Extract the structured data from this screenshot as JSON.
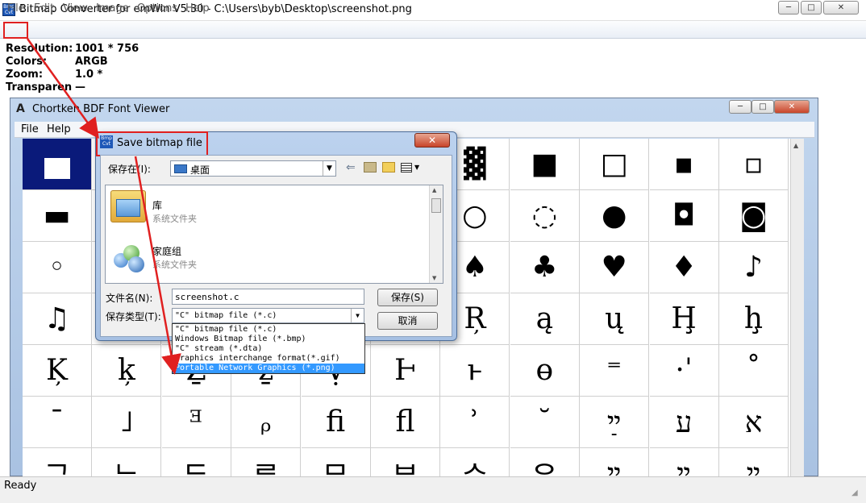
{
  "window": {
    "title": "Bitmap Converter for emWin V5.30 - C:\\Users\\byb\\Desktop\\screenshot.png",
    "icon_text": "Bmp Cvt",
    "minimize": "─",
    "maximize": "□",
    "close": "✕"
  },
  "menu": [
    "File",
    "Edit",
    "View",
    "Image",
    "Options",
    "Help"
  ],
  "info": {
    "resolution_label": "Resolution:",
    "resolution_value": "1001 * 756",
    "colors_label": "Colors:",
    "colors_value": "ARGB",
    "zoom_label": "Zoom:",
    "zoom_value": "1.0 *",
    "transparency_label": "Transparen",
    "transparency_value": "—"
  },
  "viewer": {
    "title": "Chortkeh BDF Font Viewer",
    "menu": [
      "File",
      "Help"
    ],
    "glyphs": [
      [
        "",
        "",
        "",
        "",
        "",
        "",
        "▓",
        "■",
        "□",
        "▪",
        "▫"
      ],
      [
        "▬",
        "",
        "",
        "",
        "",
        "",
        "○",
        "◌",
        "●",
        "◘",
        "◙"
      ],
      [
        "◦",
        "",
        "",
        "",
        "",
        "",
        "♠",
        "♣",
        "♥",
        "♦",
        "♪"
      ],
      [
        "♫",
        "",
        "",
        "",
        "",
        "",
        "Ŗ",
        "ą",
        "ų",
        "Ḩ",
        "ḩ"
      ],
      [
        "Ķ",
        "ķ",
        "Ẕ",
        "ẕ",
        "Ṿ",
        "Ͱ",
        "ͱ",
        "ɵ",
        "⁼",
        "·ˈ",
        "˚"
      ],
      [
        "ˉ",
        "˩",
        "ᴲ",
        "ᵨ",
        "ﬁ",
        "ﬂ",
        "ʾ",
        "˘",
        "ײַ",
        "ע",
        "א"
      ],
      [
        "ᄀ",
        "ᄂ",
        "ᄃ",
        "ᄅ",
        "ᄆ",
        "ᄇ",
        "ᄉ",
        "ᄋ",
        "ײ",
        "ײ",
        "ײ"
      ]
    ]
  },
  "dialog": {
    "title": "Save bitmap file",
    "save_in_label": "保存在(I):",
    "save_in_value": "桌面",
    "places": [
      {
        "name": "库",
        "type": "系统文件夹",
        "icon": "library-icon"
      },
      {
        "name": "家庭组",
        "type": "系统文件夹",
        "icon": "homegroup-icon"
      }
    ],
    "filename_label": "文件名(N):",
    "filename_value": "screenshot.c",
    "filetype_label": "保存类型(T):",
    "filetype_value": "\"C\" bitmap file (*.c)",
    "save_button": "保存(S)",
    "cancel_button": "取消",
    "filetype_options": [
      "\"C\" bitmap file (*.c)",
      "Windows Bitmap file (*.bmp)",
      "\"C\" stream (*.dta)",
      "Graphics interchange format(*.gif)",
      "Portable Network Graphics (*.png)"
    ],
    "selected_option_index": 4
  },
  "status": {
    "text": "Ready"
  },
  "colors": {
    "highlight": "#3399ff",
    "annotation": "#e02020",
    "selection_cell": "#0a1a7a"
  }
}
